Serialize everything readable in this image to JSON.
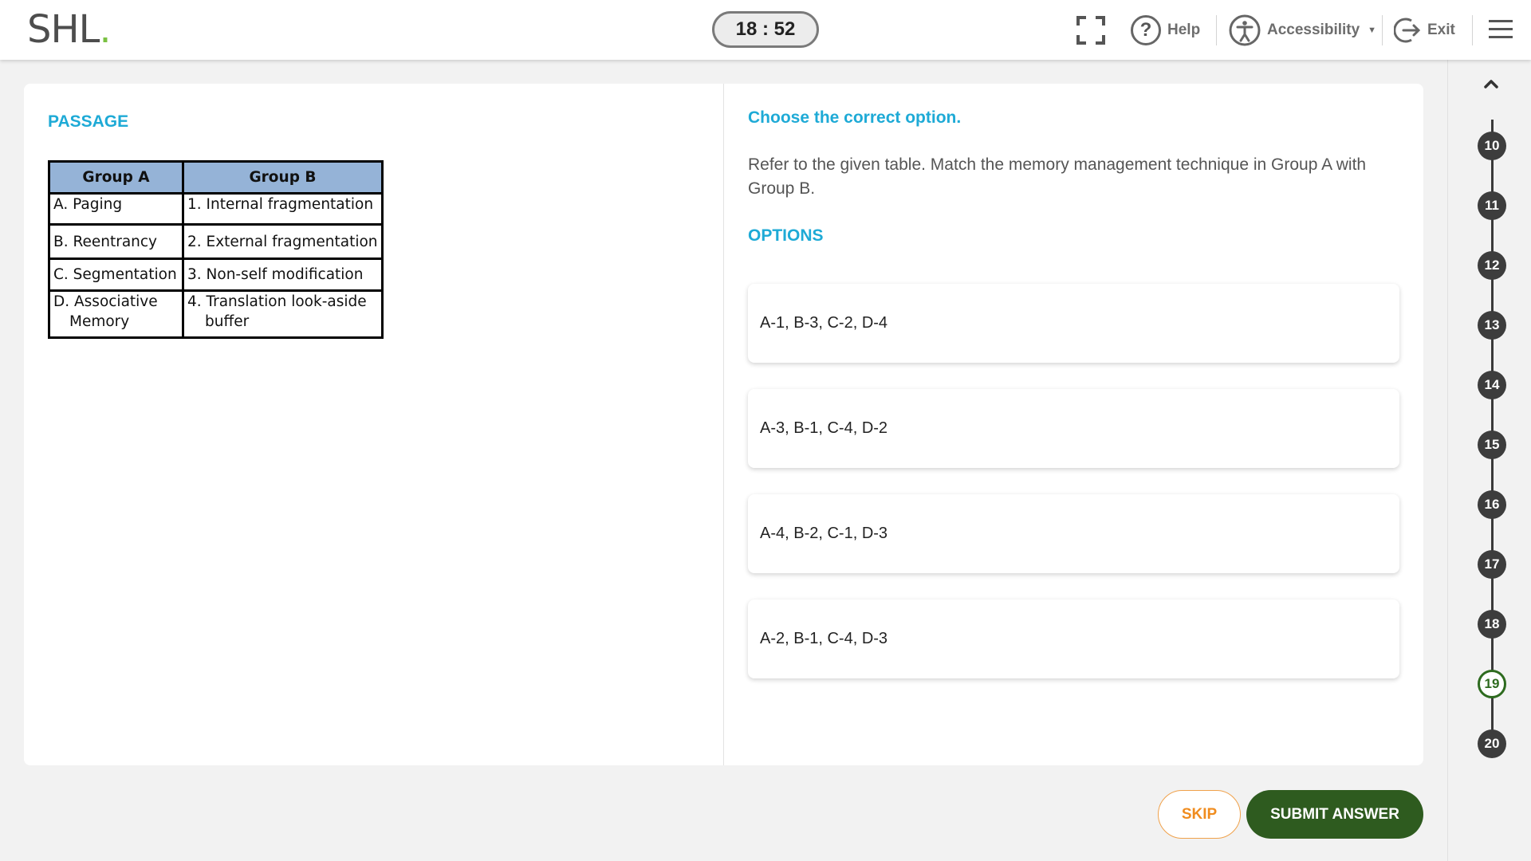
{
  "header": {
    "logo": "SHL",
    "timer": "18 : 52",
    "fullscreen_icon": "fullscreen-icon",
    "help_label": "Help",
    "accessibility_label": "Accessibility",
    "exit_label": "Exit"
  },
  "passage": {
    "title": "PASSAGE",
    "table": {
      "headers": [
        "Group A",
        "Group B"
      ],
      "rows": [
        {
          "a": "A. Paging",
          "b": "1. Internal fragmentation"
        },
        {
          "a": "B. Reentrancy",
          "b": "2. External fragmentation"
        },
        {
          "a": "C. Segmentation",
          "b": "3. Non-self modification"
        },
        {
          "a1": "D. Associative",
          "a2": "Memory",
          "b1": "4. Translation look-aside",
          "b2": "buffer"
        }
      ]
    }
  },
  "question": {
    "instruction": "Choose the correct option.",
    "text": "Refer to the given table. Match the memory management technique in Group A with Group B.",
    "options_title": "OPTIONS",
    "options": [
      "A-1, B-3, C-2, D-4",
      "A-3, B-1, C-4, D-2",
      "A-4, B-2, C-1, D-3",
      "A-2, B-1, C-4, D-3"
    ]
  },
  "actions": {
    "skip": "SKIP",
    "submit": "SUBMIT ANSWER"
  },
  "navigator": {
    "questions": [
      "10",
      "11",
      "12",
      "13",
      "14",
      "15",
      "16",
      "17",
      "18",
      "19",
      "20"
    ],
    "current": "19"
  },
  "colors": {
    "accent": "#1eaad6",
    "submit": "#2e5b1f",
    "skip": "#f08c1e",
    "table_header": "#95b3d7"
  }
}
